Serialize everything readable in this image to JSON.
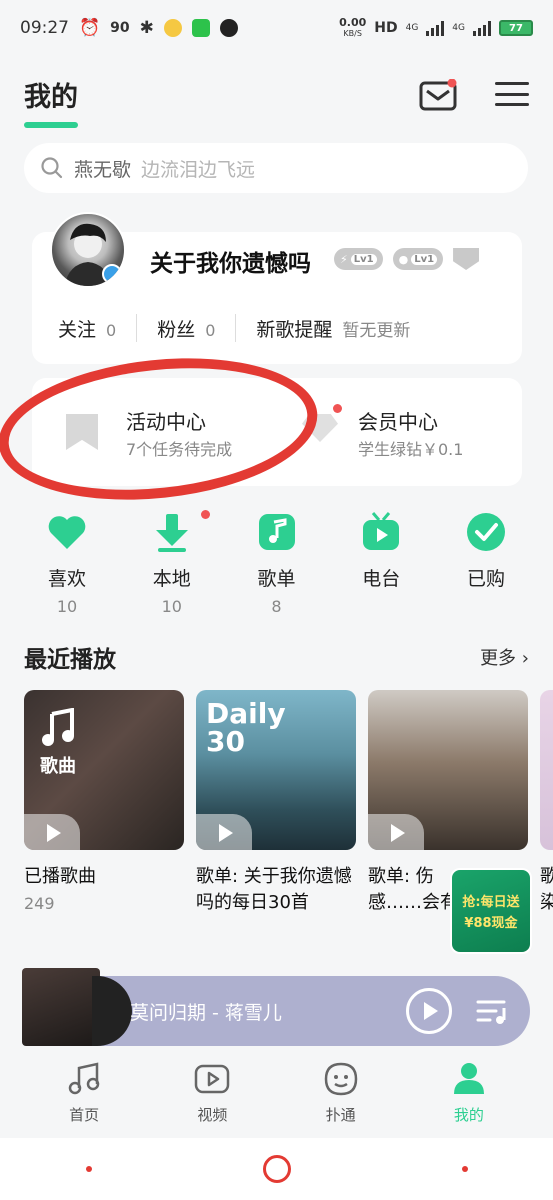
{
  "status_bar": {
    "time": "09:27",
    "network_speed": "90",
    "data_rate": "0.00",
    "data_unit": "KB/S",
    "hd": "HD",
    "net1": "4G",
    "net2": "4G",
    "battery": "77"
  },
  "header": {
    "title": "我的"
  },
  "search": {
    "name": "燕无歇",
    "hint": "边流泪边飞远"
  },
  "profile": {
    "username": "关于我你遗憾吗",
    "level1": "Lv1",
    "level2": "Lv1",
    "follow_label": "关注",
    "follow_count": "0",
    "fans_label": "粉丝",
    "fans_count": "0",
    "new_song_label": "新歌提醒",
    "new_song_status": "暂无更新"
  },
  "activity": {
    "title": "活动中心",
    "subtitle": "7个任务待完成"
  },
  "vip": {
    "title": "会员中心",
    "subtitle": "学生绿钻￥0.1"
  },
  "shortcuts": [
    {
      "label": "喜欢",
      "count": "10"
    },
    {
      "label": "本地",
      "count": "10"
    },
    {
      "label": "歌单",
      "count": "8"
    },
    {
      "label": "电台",
      "count": ""
    },
    {
      "label": "已购",
      "count": ""
    }
  ],
  "recent": {
    "title": "最近播放",
    "more": "更多",
    "items": [
      {
        "title": "已播歌曲",
        "count": "249",
        "cover_label": "歌曲"
      },
      {
        "title": "歌单: 关于我你遗憾吗的每日30首",
        "count": "",
        "cover_label": "Daily 30"
      },
      {
        "title": "歌单: 伤感……会有个人……",
        "count": ""
      },
      {
        "title": "歌染",
        "count": ""
      }
    ]
  },
  "promo": {
    "line1": "抢:每日送",
    "line2": "¥88现金"
  },
  "player": {
    "song": "莫问归期 - 蒋雪儿"
  },
  "tabs": [
    {
      "label": "首页"
    },
    {
      "label": "视频"
    },
    {
      "label": "扑通"
    },
    {
      "label": "我的"
    }
  ],
  "colors": {
    "accent": "#2dcf91",
    "red_dot": "#f05454",
    "player_bg": "#aeb0cf"
  }
}
